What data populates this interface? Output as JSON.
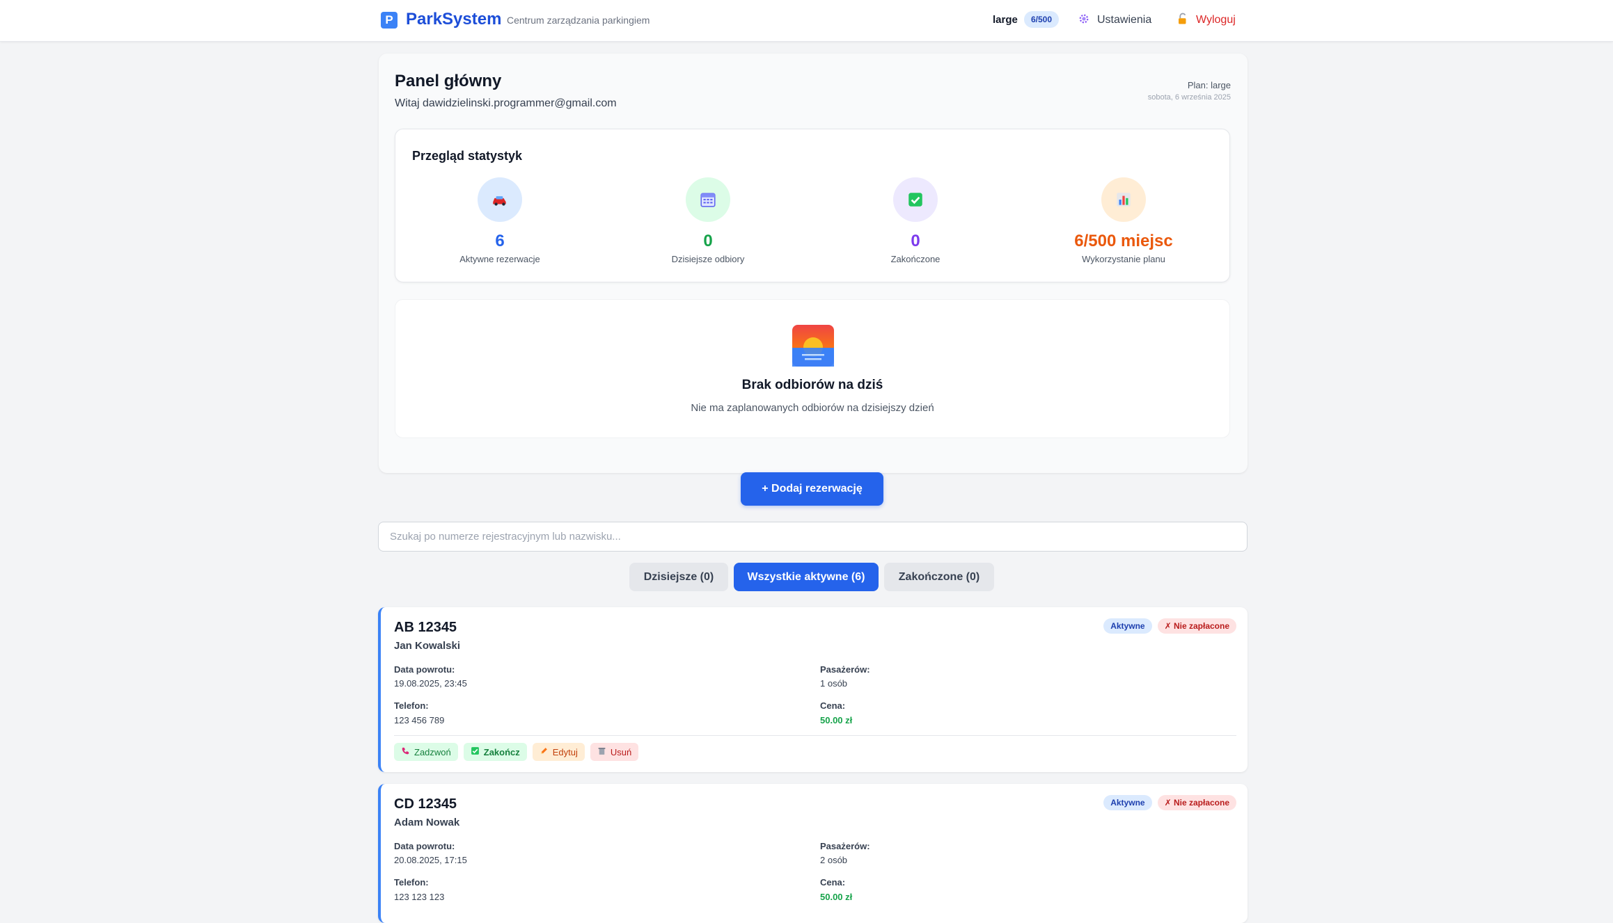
{
  "app": {
    "brand": "ParkSystem",
    "brand_mark": "P",
    "tagline": "Centrum zarządzania parkingiem",
    "plan_name": "large",
    "plan_usage": "6/500",
    "settings_label": "Ustawienia",
    "logout_label": "Wyloguj"
  },
  "dashboard": {
    "title": "Panel główny",
    "welcome": "Witaj dawidzielinski.programmer@gmail.com",
    "plan_label": "Plan: large",
    "date_label": "sobota, 6 września 2025"
  },
  "stats": {
    "title": "Przegląd statystyk",
    "items": [
      {
        "value": "6",
        "label": "Aktywne rezerwacje",
        "icon": "car-icon",
        "color": "#2563eb",
        "bg": "#dbeafe"
      },
      {
        "value": "0",
        "label": "Dzisiejsze odbiory",
        "icon": "calendar-icon",
        "color": "#16a34a",
        "bg": "#dcfce7"
      },
      {
        "value": "0",
        "label": "Zakończone",
        "icon": "checkmark-icon",
        "color": "#7c3aed",
        "bg": "#ede9fe"
      },
      {
        "value": "6/500 miejsc",
        "label": "Wykorzystanie planu",
        "icon": "bar-chart-icon",
        "color": "#ea580c",
        "bg": "#ffedd5"
      }
    ]
  },
  "empty_state": {
    "title": "Brak odbiorów na dziś",
    "description": "Nie ma zaplanowanych odbiorów na dzisiejszy dzień",
    "icon": "sunrise-icon"
  },
  "add_button": "+ Dodaj rezerwację",
  "search": {
    "placeholder": "Szukaj po numerze rejestracyjnym lub nazwisku..."
  },
  "tabs": [
    {
      "label": "Dzisiejsze (0)",
      "active": false
    },
    {
      "label": "Wszystkie aktywne (6)",
      "active": true
    },
    {
      "label": "Zakończone (0)",
      "active": false
    }
  ],
  "labels": {
    "return_date": "Data powrotu:",
    "phone": "Telefon:",
    "passengers": "Pasażerów:",
    "price": "Cena:"
  },
  "actions": {
    "call": "Zadzwoń",
    "finish": "Zakończ",
    "edit": "Edytuj",
    "delete": "Usuń"
  },
  "reservations": [
    {
      "plate": "AB 12345",
      "owner": "Jan Kowalski",
      "status": "Aktywne",
      "payment": "✗ Nie zapłacone",
      "return_date": "19.08.2025, 23:45",
      "phone": "123 456 789",
      "passengers": "1 osób",
      "price": "50.00 zł"
    },
    {
      "plate": "CD 12345",
      "owner": "Adam Nowak",
      "status": "Aktywne",
      "payment": "✗ Nie zapłacone",
      "return_date": "20.08.2025, 17:15",
      "phone": "123 123 123",
      "passengers": "2 osób",
      "price": "50.00 zł"
    }
  ]
}
